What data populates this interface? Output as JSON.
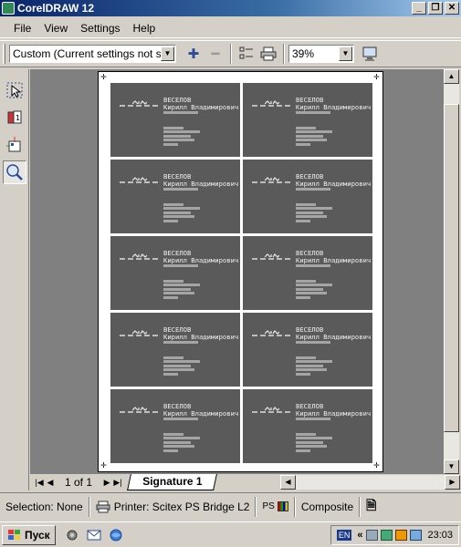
{
  "window": {
    "title": "CorelDRAW 12",
    "controls": [
      "_",
      "❐",
      "✕"
    ]
  },
  "menu": {
    "items": [
      "File",
      "View",
      "Settings",
      "Help"
    ]
  },
  "toolbar": {
    "preset_value": "Custom (Current settings not s...",
    "zoom_value": "39%"
  },
  "card": {
    "surname": "ВЕСЕЛОВ",
    "fullname": "Кирилл Владимирович"
  },
  "nav": {
    "page_indicator": "1 of 1",
    "tab_label": "Signature 1"
  },
  "status": {
    "selection": "Selection: None",
    "printer": "Printer: Scitex PS Bridge L2",
    "ps_label": "PS",
    "composite": "Composite"
  },
  "taskbar": {
    "start_label": "Пуск",
    "lang": "EN",
    "clock": "23:03"
  },
  "colors": {
    "card_fill": "#5a5a5a",
    "title_blue": "#0a246a"
  }
}
